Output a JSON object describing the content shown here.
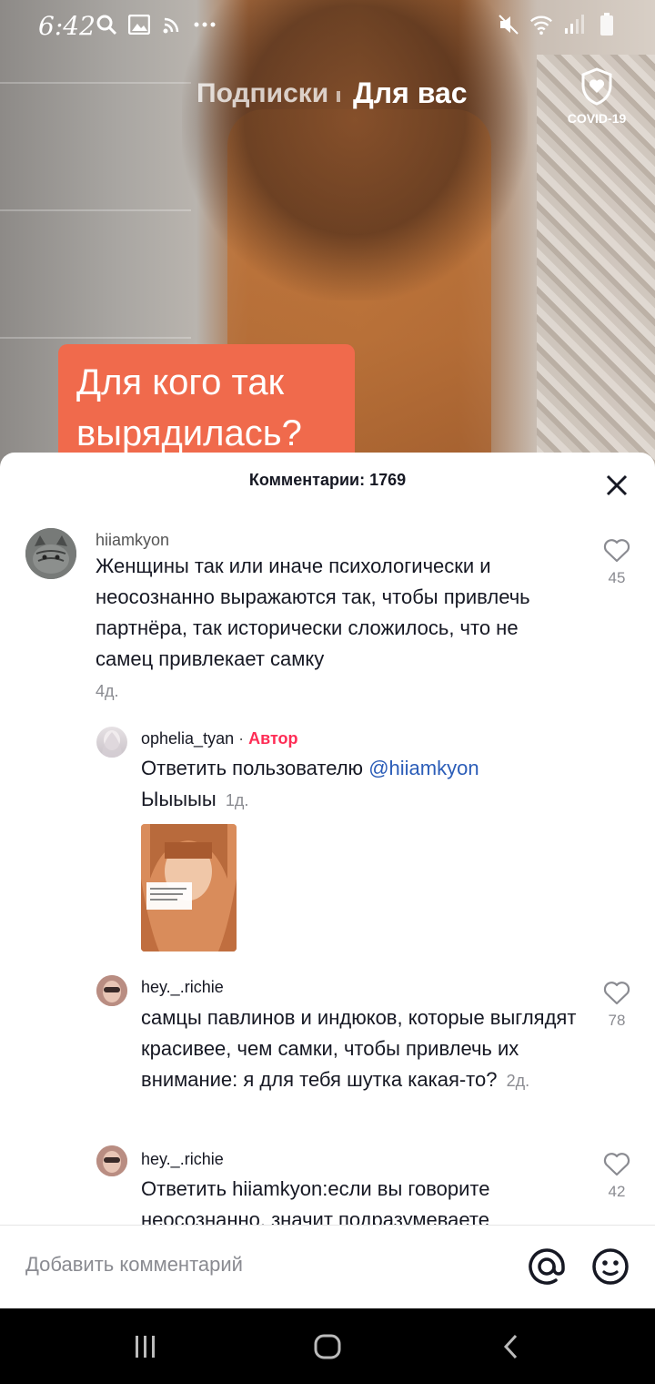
{
  "status_bar": {
    "time": "6:42"
  },
  "top_nav": {
    "following": "Подписки",
    "for_you": "Для вас",
    "covid_label": "COVID-19"
  },
  "video": {
    "caption_line1": "Для кого так",
    "caption_line2": "вырядилась?"
  },
  "comments_sheet": {
    "title": "Комментарии: 1769",
    "comments": [
      {
        "username": "hiiamkyon",
        "text": "Женщины так или иначе психологически и неосознанно выражаются так, чтобы привлечь партнёра, так исторически сложилось, что не самец привлекает самку",
        "time": "4д.",
        "likes": "45"
      },
      {
        "username": "ophelia_tyan",
        "separator": "·",
        "author_badge": "Автор",
        "reply_prefix": "Ответить пользователю",
        "mention": "@hiiamkyon",
        "text": "Ыыыыы",
        "time": "1д."
      },
      {
        "username": "hey._.richie",
        "text": "самцы павлинов и индюков, которые выглядят красивее, чем самки, чтобы привлечь их внимание: я для тебя шутка какая-то?",
        "time": "2д.",
        "likes": "78"
      },
      {
        "username": "hey._.richie",
        "reply_prefix": "Ответить",
        "reply_user": "hiiamkyon",
        "text": ":если вы говорите неосознанно, значит подразумеваете",
        "likes": "42"
      }
    ]
  },
  "input": {
    "placeholder": "Добавить комментарий"
  },
  "colors": {
    "accent": "#fe2c55",
    "mention": "#2b5db8",
    "caption_bg": "#f06a4c"
  }
}
